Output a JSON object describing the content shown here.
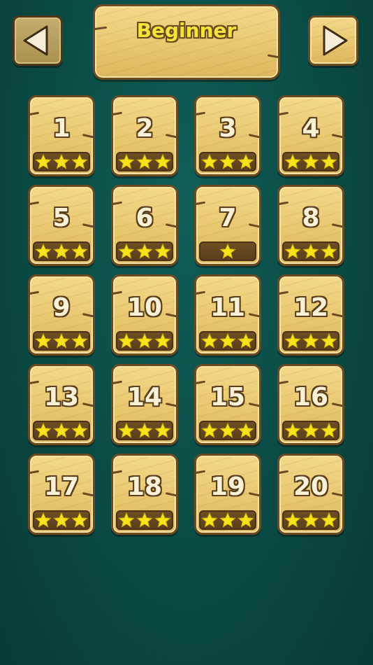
{
  "header": {
    "title": "Beginner",
    "prev_icon": "triangle-left-icon",
    "next_icon": "triangle-right-icon"
  },
  "levels": [
    {
      "number": "1",
      "stars": 3
    },
    {
      "number": "2",
      "stars": 3
    },
    {
      "number": "3",
      "stars": 3
    },
    {
      "number": "4",
      "stars": 3
    },
    {
      "number": "5",
      "stars": 3
    },
    {
      "number": "6",
      "stars": 3
    },
    {
      "number": "7",
      "stars": 1
    },
    {
      "number": "8",
      "stars": 3
    },
    {
      "number": "9",
      "stars": 3
    },
    {
      "number": "10",
      "stars": 3
    },
    {
      "number": "11",
      "stars": 3
    },
    {
      "number": "12",
      "stars": 3
    },
    {
      "number": "13",
      "stars": 3
    },
    {
      "number": "14",
      "stars": 3
    },
    {
      "number": "15",
      "stars": 3
    },
    {
      "number": "16",
      "stars": 3
    },
    {
      "number": "17",
      "stars": 3
    },
    {
      "number": "18",
      "stars": 3
    },
    {
      "number": "19",
      "stars": 3
    },
    {
      "number": "20",
      "stars": 3
    }
  ],
  "colors": {
    "background": "#0b4a44",
    "wood": "#e8c66e",
    "wood_border": "#6b4a22",
    "title_text": "#f5e23a",
    "star": "#f7e21c",
    "star_bar": "#5a3f1c"
  }
}
